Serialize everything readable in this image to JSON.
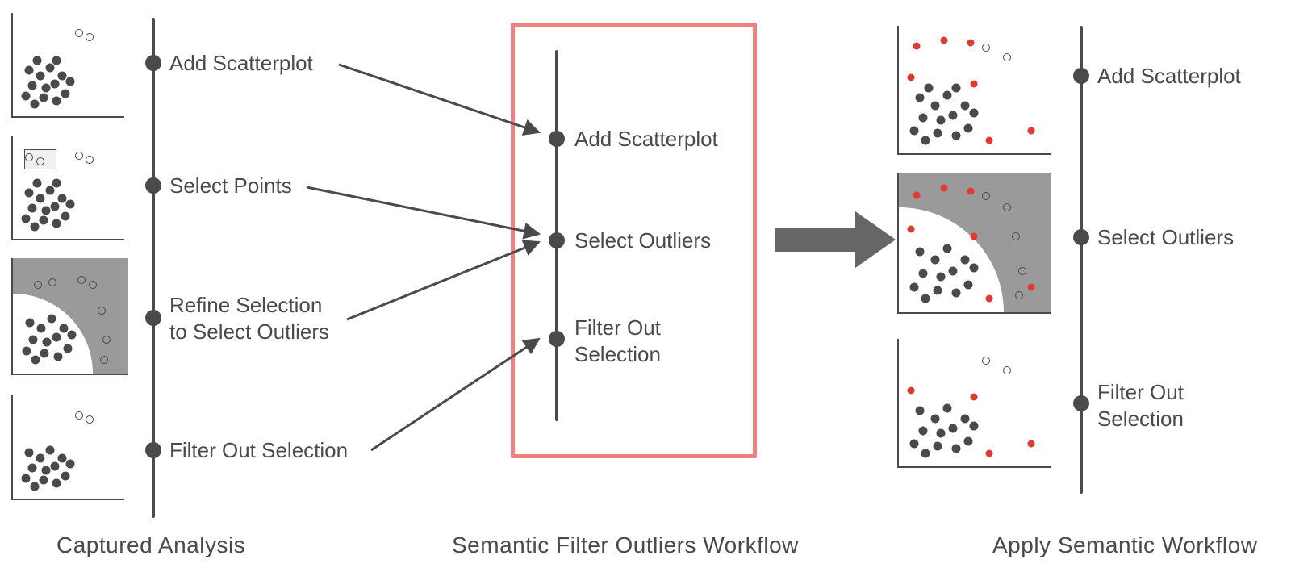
{
  "captions": {
    "left": "Captured Analysis",
    "middle": "Semantic Filter Outliers Workflow",
    "right": "Apply Semantic Workflow"
  },
  "left_steps": {
    "s1": "Add Scatterplot",
    "s2": "Select Points",
    "s3_line1": "Refine Selection",
    "s3_line2": "to Select Outliers",
    "s4": "Filter Out Selection"
  },
  "middle_steps": {
    "s1": "Add Scatterplot",
    "s2": "Select Outliers",
    "s3_line1": "Filter Out",
    "s3_line2": "Selection"
  },
  "right_steps": {
    "s1": "Add Scatterplot",
    "s2": "Select Outliers",
    "s3_line1": "Filter Out",
    "s3_line2": "Selection"
  },
  "colors": {
    "ink": "#4a4a4a",
    "highlight_border": "#f08080",
    "red_dot": "#e03a2f",
    "shade": "#9a9a9a"
  },
  "chart_data": [
    {
      "type": "scatter",
      "id": "left-1-add-scatterplot",
      "xlim": [
        0,
        100
      ],
      "ylim": [
        0,
        100
      ],
      "series": [
        {
          "name": "cluster",
          "style": "filled-dark",
          "points": [
            [
              12,
              20
            ],
            [
              20,
              12
            ],
            [
              28,
              18
            ],
            [
              18,
              30
            ],
            [
              30,
              28
            ],
            [
              40,
              15
            ],
            [
              25,
              40
            ],
            [
              38,
              32
            ],
            [
              48,
              22
            ],
            [
              15,
              45
            ],
            [
              34,
              48
            ],
            [
              45,
              40
            ],
            [
              52,
              34
            ],
            [
              22,
              55
            ],
            [
              40,
              55
            ]
          ]
        },
        {
          "name": "outliers",
          "style": "open-dark",
          "points": [
            [
              60,
              82
            ],
            [
              70,
              78
            ]
          ]
        }
      ]
    },
    {
      "type": "scatter",
      "id": "left-2-select-points",
      "xlim": [
        0,
        100
      ],
      "ylim": [
        0,
        100
      ],
      "selection": {
        "kind": "rect",
        "x": 10,
        "y": 70,
        "w": 28,
        "h": 18
      },
      "series": [
        {
          "name": "cluster",
          "style": "filled-dark",
          "points": [
            [
              12,
              20
            ],
            [
              20,
              12
            ],
            [
              28,
              18
            ],
            [
              18,
              30
            ],
            [
              30,
              28
            ],
            [
              40,
              15
            ],
            [
              25,
              40
            ],
            [
              38,
              32
            ],
            [
              48,
              22
            ],
            [
              15,
              45
            ],
            [
              34,
              48
            ],
            [
              45,
              40
            ],
            [
              52,
              34
            ],
            [
              22,
              55
            ],
            [
              40,
              55
            ]
          ]
        },
        {
          "name": "selected",
          "style": "open-dark",
          "points": [
            [
              15,
              80
            ],
            [
              25,
              76
            ]
          ]
        },
        {
          "name": "outliers",
          "style": "open-dark",
          "points": [
            [
              60,
              82
            ],
            [
              70,
              78
            ]
          ]
        }
      ]
    },
    {
      "type": "scatter",
      "id": "left-3-refine-selection",
      "xlim": [
        0,
        100
      ],
      "ylim": [
        0,
        100
      ],
      "selection": {
        "kind": "outside-quarter-circle",
        "cx": 0,
        "cy": 0,
        "r": 70
      },
      "series": [
        {
          "name": "cluster-unselected",
          "style": "filled-dark",
          "points": [
            [
              12,
              20
            ],
            [
              20,
              12
            ],
            [
              28,
              18
            ],
            [
              18,
              30
            ],
            [
              30,
              28
            ],
            [
              40,
              15
            ],
            [
              25,
              40
            ],
            [
              38,
              32
            ],
            [
              48,
              22
            ],
            [
              15,
              45
            ],
            [
              34,
              48
            ],
            [
              45,
              40
            ],
            [
              52,
              34
            ]
          ]
        },
        {
          "name": "selected-outliers",
          "style": "open-dark",
          "points": [
            [
              22,
              78
            ],
            [
              35,
              80
            ],
            [
              60,
              82
            ],
            [
              70,
              78
            ],
            [
              78,
              55
            ],
            [
              82,
              30
            ],
            [
              80,
              12
            ]
          ]
        }
      ]
    },
    {
      "type": "scatter",
      "id": "left-4-filtered",
      "xlim": [
        0,
        100
      ],
      "ylim": [
        0,
        100
      ],
      "series": [
        {
          "name": "cluster",
          "style": "filled-dark",
          "points": [
            [
              12,
              20
            ],
            [
              20,
              12
            ],
            [
              28,
              18
            ],
            [
              18,
              30
            ],
            [
              30,
              28
            ],
            [
              40,
              15
            ],
            [
              25,
              40
            ],
            [
              38,
              32
            ],
            [
              48,
              22
            ],
            [
              15,
              45
            ],
            [
              34,
              48
            ],
            [
              45,
              40
            ],
            [
              52,
              34
            ]
          ]
        },
        {
          "name": "outliers",
          "style": "open-dark",
          "points": [
            [
              60,
              82
            ],
            [
              70,
              78
            ]
          ]
        }
      ]
    },
    {
      "type": "scatter",
      "id": "right-1-new-data",
      "xlim": [
        0,
        100
      ],
      "ylim": [
        0,
        100
      ],
      "series": [
        {
          "name": "cluster",
          "style": "filled-dark",
          "points": [
            [
              10,
              18
            ],
            [
              18,
              10
            ],
            [
              26,
              16
            ],
            [
              16,
              28
            ],
            [
              28,
              26
            ],
            [
              38,
              14
            ],
            [
              24,
              38
            ],
            [
              36,
              30
            ],
            [
              46,
              20
            ],
            [
              14,
              44
            ],
            [
              32,
              46
            ],
            [
              44,
              38
            ],
            [
              50,
              32
            ],
            [
              20,
              52
            ],
            [
              38,
              52
            ]
          ]
        },
        {
          "name": "outliers",
          "style": "open-dark",
          "points": [
            [
              58,
              84
            ],
            [
              72,
              76
            ]
          ]
        },
        {
          "name": "new-red",
          "style": "filled-red",
          "points": [
            [
              12,
              85
            ],
            [
              30,
              90
            ],
            [
              48,
              88
            ],
            [
              8,
              60
            ],
            [
              50,
              55
            ],
            [
              88,
              18
            ],
            [
              60,
              10
            ]
          ]
        }
      ]
    },
    {
      "type": "scatter",
      "id": "right-2-select-outliers",
      "xlim": [
        0,
        100
      ],
      "ylim": [
        0,
        100
      ],
      "selection": {
        "kind": "outside-quarter-circle",
        "cx": 0,
        "cy": 0,
        "r": 70
      },
      "series": [
        {
          "name": "cluster-unselected",
          "style": "filled-dark",
          "points": [
            [
              10,
              18
            ],
            [
              18,
              10
            ],
            [
              26,
              16
            ],
            [
              16,
              28
            ],
            [
              28,
              26
            ],
            [
              38,
              14
            ],
            [
              24,
              38
            ],
            [
              36,
              30
            ],
            [
              46,
              20
            ],
            [
              14,
              44
            ],
            [
              32,
              46
            ],
            [
              44,
              38
            ],
            [
              50,
              32
            ]
          ]
        },
        {
          "name": "selected-open",
          "style": "open-dark",
          "points": [
            [
              58,
              84
            ],
            [
              72,
              76
            ],
            [
              78,
              55
            ],
            [
              82,
              30
            ],
            [
              80,
              12
            ]
          ]
        },
        {
          "name": "red-unselected",
          "style": "filled-red",
          "points": [
            [
              8,
              60
            ],
            [
              50,
              55
            ],
            [
              60,
              10
            ]
          ]
        },
        {
          "name": "red-selected",
          "style": "filled-red",
          "points": [
            [
              12,
              85
            ],
            [
              30,
              90
            ],
            [
              48,
              88
            ],
            [
              88,
              18
            ]
          ]
        }
      ]
    },
    {
      "type": "scatter",
      "id": "right-3-filtered",
      "xlim": [
        0,
        100
      ],
      "ylim": [
        0,
        100
      ],
      "series": [
        {
          "name": "cluster",
          "style": "filled-dark",
          "points": [
            [
              10,
              18
            ],
            [
              18,
              10
            ],
            [
              26,
              16
            ],
            [
              16,
              28
            ],
            [
              28,
              26
            ],
            [
              38,
              14
            ],
            [
              24,
              38
            ],
            [
              36,
              30
            ],
            [
              46,
              20
            ],
            [
              14,
              44
            ],
            [
              32,
              46
            ],
            [
              44,
              38
            ],
            [
              50,
              32
            ]
          ]
        },
        {
          "name": "remaining-red",
          "style": "filled-red",
          "points": [
            [
              8,
              60
            ],
            [
              50,
              55
            ],
            [
              60,
              10
            ],
            [
              88,
              18
            ]
          ]
        },
        {
          "name": "outliers-open",
          "style": "open-dark",
          "points": [
            [
              58,
              84
            ],
            [
              72,
              76
            ]
          ]
        }
      ]
    }
  ]
}
